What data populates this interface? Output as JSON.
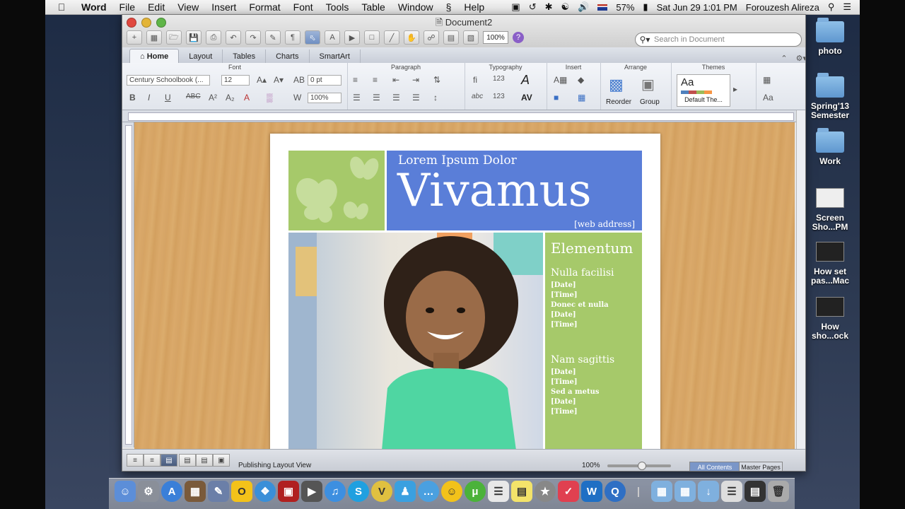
{
  "menubar": {
    "app_name": "Word",
    "items": [
      "File",
      "Edit",
      "View",
      "Insert",
      "Format",
      "Font",
      "Tools",
      "Table",
      "Window",
      "Help"
    ],
    "battery": "57%",
    "clock": "Sat Jun 29  1:01 PM",
    "user": "Forouzesh Alireza"
  },
  "window": {
    "title": "Document2",
    "zoom_box": "100%",
    "search_placeholder": "Search in Document"
  },
  "ribbon_tabs": [
    "Home",
    "Layout",
    "Tables",
    "Charts",
    "SmartArt"
  ],
  "ribbon": {
    "font_group": "Font",
    "font_name": "Century Schoolbook (...",
    "font_size": "12",
    "char_spacing": "0 pt",
    "scale": "100%",
    "paragraph_group": "Paragraph",
    "typography_group": "Typography",
    "insert_group": "Insert",
    "arrange_group": "Arrange",
    "reorder_label": "Reorder",
    "group_label": "Group",
    "themes_group": "Themes",
    "theme_name": "Default The...",
    "theme_preview": "Aa"
  },
  "document": {
    "subtitle": "Lorem Ipsum Dolor",
    "title": "Vivamus",
    "web": "[web address]",
    "side_heading": "Elementum",
    "block1_heading": "Nulla facilisi",
    "block1_lines": [
      "[Date]",
      "[Time]",
      "Donec et nulla",
      "[Date]",
      "[Time]"
    ],
    "block2_heading": "Nam sagittis",
    "block2_lines": [
      "[Date]",
      "[Time]",
      "Sed a metus",
      "[Date]",
      "[Time]"
    ]
  },
  "statusbar": {
    "view_name": "Publishing Layout View",
    "zoom": "100%",
    "tab_all": "All Contents",
    "tab_master": "Master Pages"
  },
  "desktop_icons": [
    {
      "label": "photo"
    },
    {
      "label": "Spring'13 Semester"
    },
    {
      "label": "Work"
    },
    {
      "label": "Screen Sho...PM"
    },
    {
      "label": "How set pas...Mac"
    },
    {
      "label": "How sho...ock"
    }
  ],
  "colors": {
    "doc_green": "#a6c96a",
    "doc_blue": "#5a7ed8",
    "canvas_wood": "#d7a463"
  }
}
